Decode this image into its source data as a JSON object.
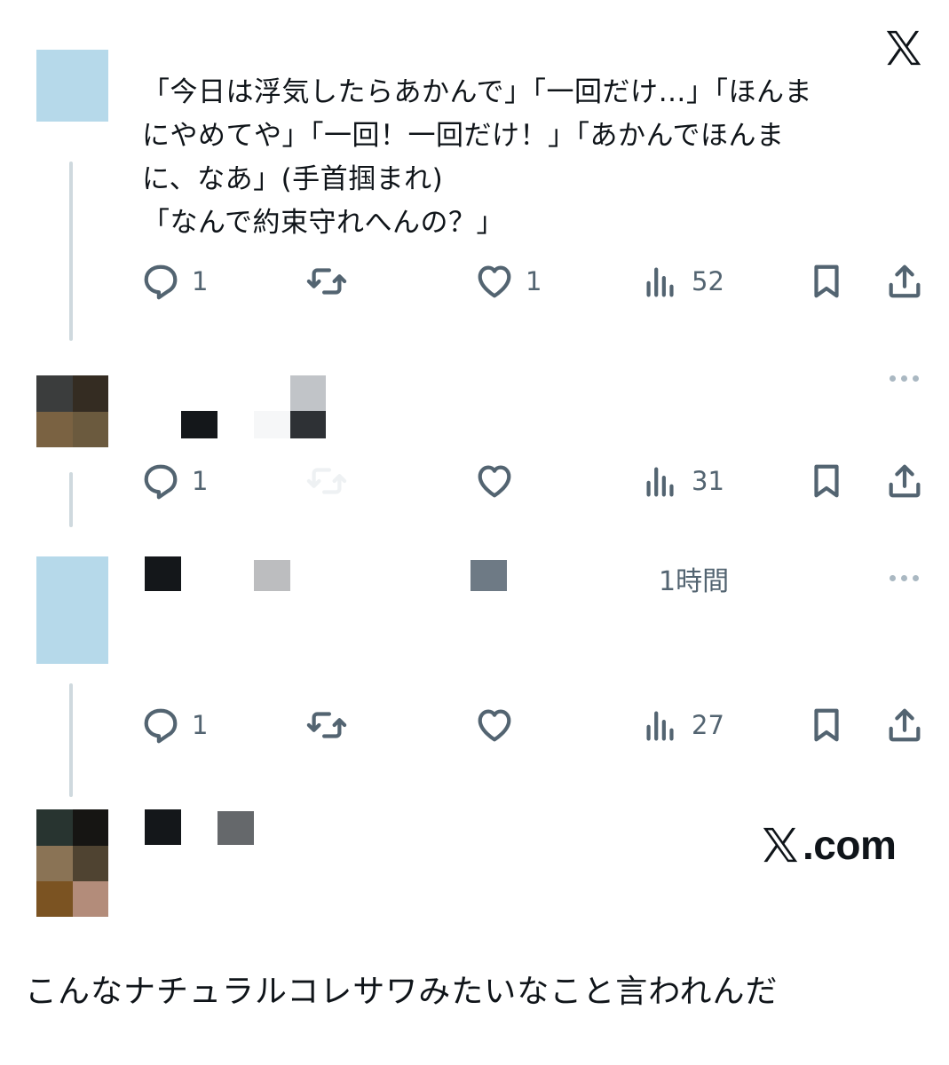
{
  "brand": {
    "logo_icon": "x-logo-icon",
    "watermark_domain": ".com"
  },
  "tweets": [
    {
      "lines": [
        "「今日は浮気したらあかんで」「一回だけ…」「ほんま",
        "にやめてや」「一回！一回だけ！」「あかんでほんま",
        "に、なあ」(手首掴まれ)",
        "「なんで約束守れへんの？」"
      ],
      "replies": "1",
      "likes": "1",
      "views": "52"
    },
    {
      "replies": "1",
      "views": "31"
    },
    {
      "timestamp": "1時間",
      "replies": "1",
      "views": "27"
    }
  ],
  "caption": "こんなナチュラルコレサワみたいなこと言われんだ",
  "colors": {
    "icon_gray": "#536471",
    "thread_line": "#cfd9de",
    "avatar_blue": "#b6d9ea"
  }
}
